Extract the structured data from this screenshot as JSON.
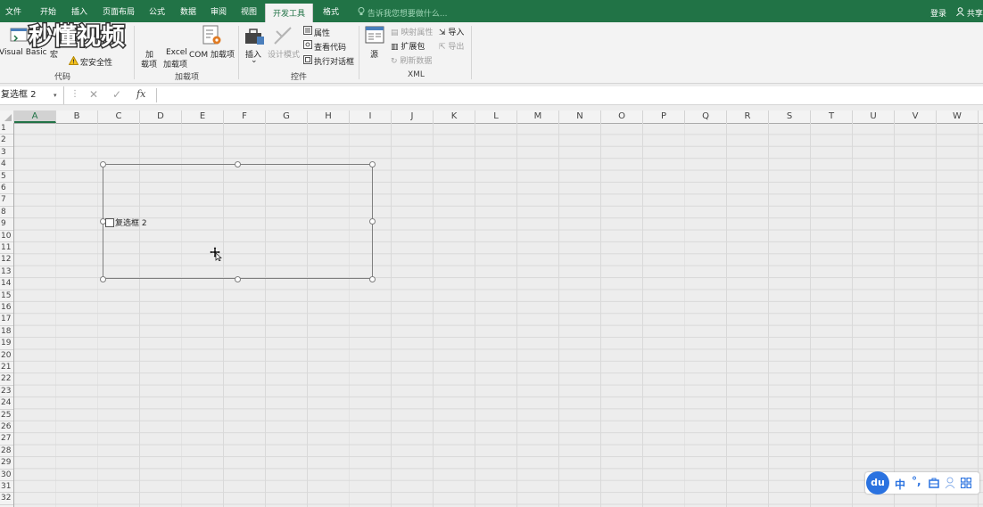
{
  "tabs": [
    "文件",
    "开始",
    "插入",
    "页面布局",
    "公式",
    "数据",
    "审阅",
    "视图",
    "开发工具",
    "格式"
  ],
  "tell_me": "告诉我您想要做什么...",
  "login": "登录",
  "share": "共享",
  "ribbon": {
    "code": {
      "visual_basic": "Visual Basic",
      "macros": "宏",
      "macro_security": "宏安全性",
      "group": "代码"
    },
    "addins": {
      "addins_1": "加",
      "addins_2": "载项",
      "excel_addins_1": "Excel",
      "excel_addins_2": "加载项",
      "com_addins": "COM 加载项",
      "group": "加载项"
    },
    "controls": {
      "insert": "插入",
      "design_mode": "设计模式",
      "properties": "属性",
      "view_code": "查看代码",
      "run_dialog": "执行对话框",
      "group": "控件"
    },
    "xml": {
      "source": "源",
      "map_properties": "映射属性",
      "expansion_packs": "扩展包",
      "refresh_data": "刷新数据",
      "import": "导入",
      "export": "导出",
      "group": "XML"
    }
  },
  "formula_bar": {
    "name_box": "复选框 2",
    "fx": "fx",
    "value": ""
  },
  "columns": [
    "A",
    "B",
    "C",
    "D",
    "E",
    "F",
    "G",
    "H",
    "I",
    "J",
    "K",
    "L",
    "M",
    "N",
    "O",
    "P",
    "Q",
    "R",
    "S",
    "T",
    "U",
    "V",
    "W"
  ],
  "rows": [
    "1",
    "2",
    "3",
    "4",
    "5",
    "6",
    "7",
    "8",
    "9",
    "10",
    "11",
    "12",
    "13",
    "14",
    "15",
    "16",
    "17",
    "18",
    "19",
    "20",
    "21",
    "22",
    "23",
    "24",
    "25",
    "26",
    "27",
    "28",
    "29",
    "30",
    "31",
    "32"
  ],
  "checkbox": {
    "label": "复选框 2",
    "checked": false
  },
  "watermark": "秒懂视频",
  "ime": {
    "logo": "du",
    "lang": "中"
  }
}
